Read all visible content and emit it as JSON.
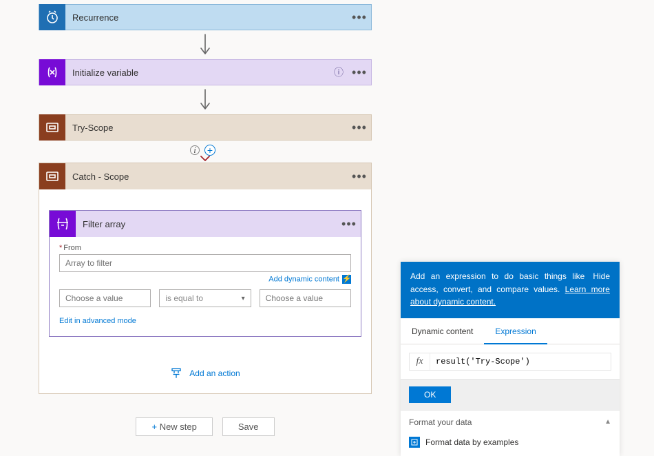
{
  "steps": {
    "recurrence": {
      "title": "Recurrence"
    },
    "init": {
      "title": "Initialize variable"
    },
    "try": {
      "title": "Try-Scope"
    },
    "catch": {
      "title": "Catch - Scope"
    },
    "filter": {
      "title": "Filter array",
      "from_label": "From",
      "from_placeholder": "Array to filter",
      "dynamic_link": "Add dynamic content",
      "left_placeholder": "Choose a value",
      "op_placeholder": "is equal to",
      "right_placeholder": "Choose a value",
      "adv_link": "Edit in advanced mode"
    },
    "add_action": "Add an action"
  },
  "footer": {
    "new_step": "New step",
    "save": "Save"
  },
  "panel": {
    "hdr_text": "Add an expression to do basic things like access, convert, and compare values. ",
    "hdr_link": "Learn more about dynamic content.",
    "hide": "Hide",
    "tab_dynamic": "Dynamic content",
    "tab_expr": "Expression",
    "fx": "fx",
    "expr_value": "result('Try-Scope')",
    "ok": "OK",
    "format_header": "Format your data",
    "format_item": "Format data by examples"
  }
}
